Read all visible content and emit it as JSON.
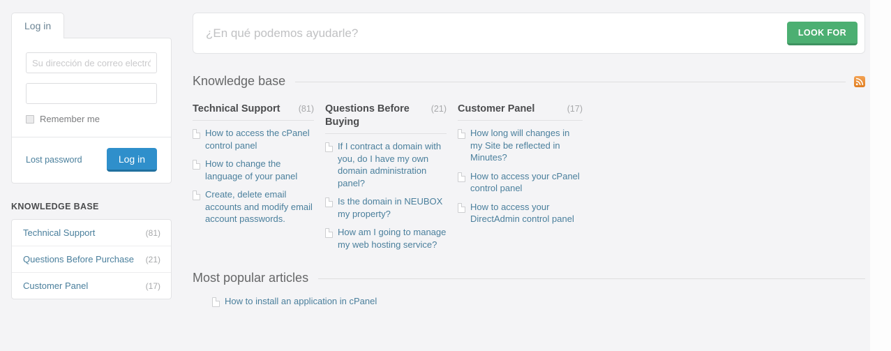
{
  "login_panel": {
    "tab_label": "Log in",
    "email_placeholder": "Su dirección de correo electrónico",
    "password_value": "",
    "password_placeholder": "",
    "remember_label": "Remember me",
    "lost_password_label": "Lost password",
    "submit_label": "Log in"
  },
  "sidebar": {
    "heading": "KNOWLEDGE BASE",
    "items": [
      {
        "label": "Technical Support",
        "count": "(81)"
      },
      {
        "label": "Questions Before Purchase",
        "count": "(21)"
      },
      {
        "label": "Customer Panel",
        "count": "(17)"
      }
    ]
  },
  "search": {
    "value": "",
    "placeholder": "¿En qué podemos ayudarle?",
    "button_label": "LOOK FOR"
  },
  "knowledge_base": {
    "heading": "Knowledge base",
    "rss_icon": "rss-icon",
    "columns": [
      {
        "title": "Technical Support",
        "count": "(81)",
        "articles": [
          "How to access the cPanel control panel",
          "How to change the language of your panel",
          "Create, delete email accounts and modify email account passwords."
        ]
      },
      {
        "title": "Questions Before Buying",
        "count": "(21)",
        "articles": [
          "If I contract a domain with you, do I have my own domain administration panel?",
          "Is the domain in NEUBOX my property?",
          "How am I going to manage my web hosting service?"
        ]
      },
      {
        "title": "Customer Panel",
        "count": "(17)",
        "articles": [
          "How long will changes in my Site be reflected in Minutes?",
          "How to access your cPanel control panel",
          "How to access your DirectAdmin control panel"
        ]
      }
    ]
  },
  "popular": {
    "heading": "Most popular articles",
    "articles": [
      "How to install an application in cPanel"
    ]
  },
  "colors": {
    "page_background": "#f4f4f6",
    "link": "#4a7f9c",
    "login_button": "#2f8fcb",
    "search_button": "#4caf72",
    "rss_orange": "#e07d20"
  }
}
